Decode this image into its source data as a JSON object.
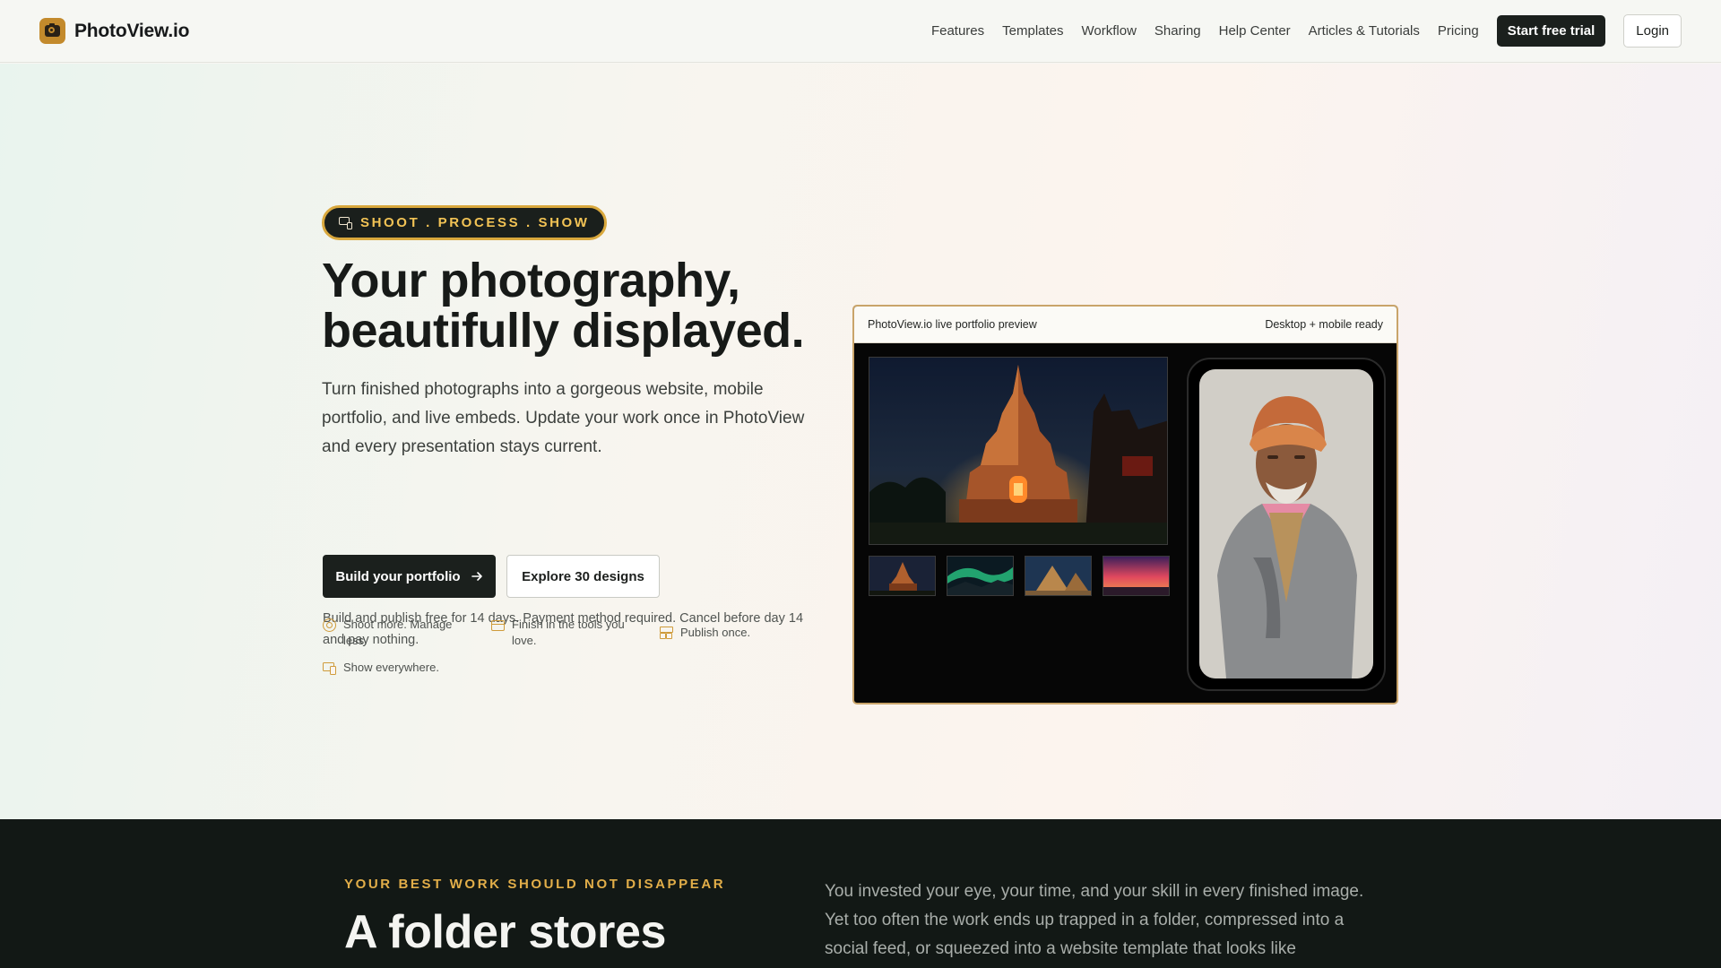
{
  "brand": {
    "name": "PhotoView.io",
    "logo_icon": "camera-icon",
    "accent": "#c38a2c"
  },
  "nav": {
    "links": [
      "Features",
      "Templates",
      "Workflow",
      "Sharing",
      "Help Center",
      "Articles & Tutorials",
      "Pricing"
    ],
    "trial_label": "Start free trial",
    "login_label": "Login"
  },
  "hero": {
    "pill": {
      "text": "SHOOT . PROCESS . SHOW",
      "icon": "devices-icon"
    },
    "title_line1": "Your photography,",
    "title_line2": "beautifully displayed.",
    "subtitle": "Turn finished photographs into a gorgeous website, mobile portfolio, and live embeds. Update your work once in PhotoView and every presentation stays current.",
    "primary_cta": "Build your portfolio",
    "primary_cta_icon": "arrow-right-icon",
    "secondary_cta": "Explore 30 designs",
    "trial_note": "Build and publish free for 14 days. Payment method required. Cancel before day 14 and pay nothing.",
    "features": [
      {
        "label": "Shoot more. Manage less.",
        "icon": "aperture-icon"
      },
      {
        "label": "Finish in the tools you love.",
        "icon": "window-icon"
      },
      {
        "label": "Publish once.",
        "icon": "layout-icon"
      },
      {
        "label": "Show everywhere.",
        "icon": "devices-icon"
      }
    ]
  },
  "preview": {
    "title": "PhotoView.io live portfolio preview",
    "badge": "Desktop + mobile ready",
    "main_photo": "temple-at-night-photo",
    "thumbnails": [
      "temple-thumbnail",
      "aurora-thumbnail",
      "pyramids-thumbnail",
      "sunset-thumbnail"
    ],
    "phone_photo": "portrait-photo"
  },
  "dark_section": {
    "eyebrow": "YOUR BEST WORK SHOULD NOT DISAPPEAR",
    "title": "A folder stores",
    "body": "You invested your eye, your time, and your skill in every finished image. Yet too often the work ends up trapped in a folder, compressed into a social feed, or squeezed into a website template that looks like"
  }
}
